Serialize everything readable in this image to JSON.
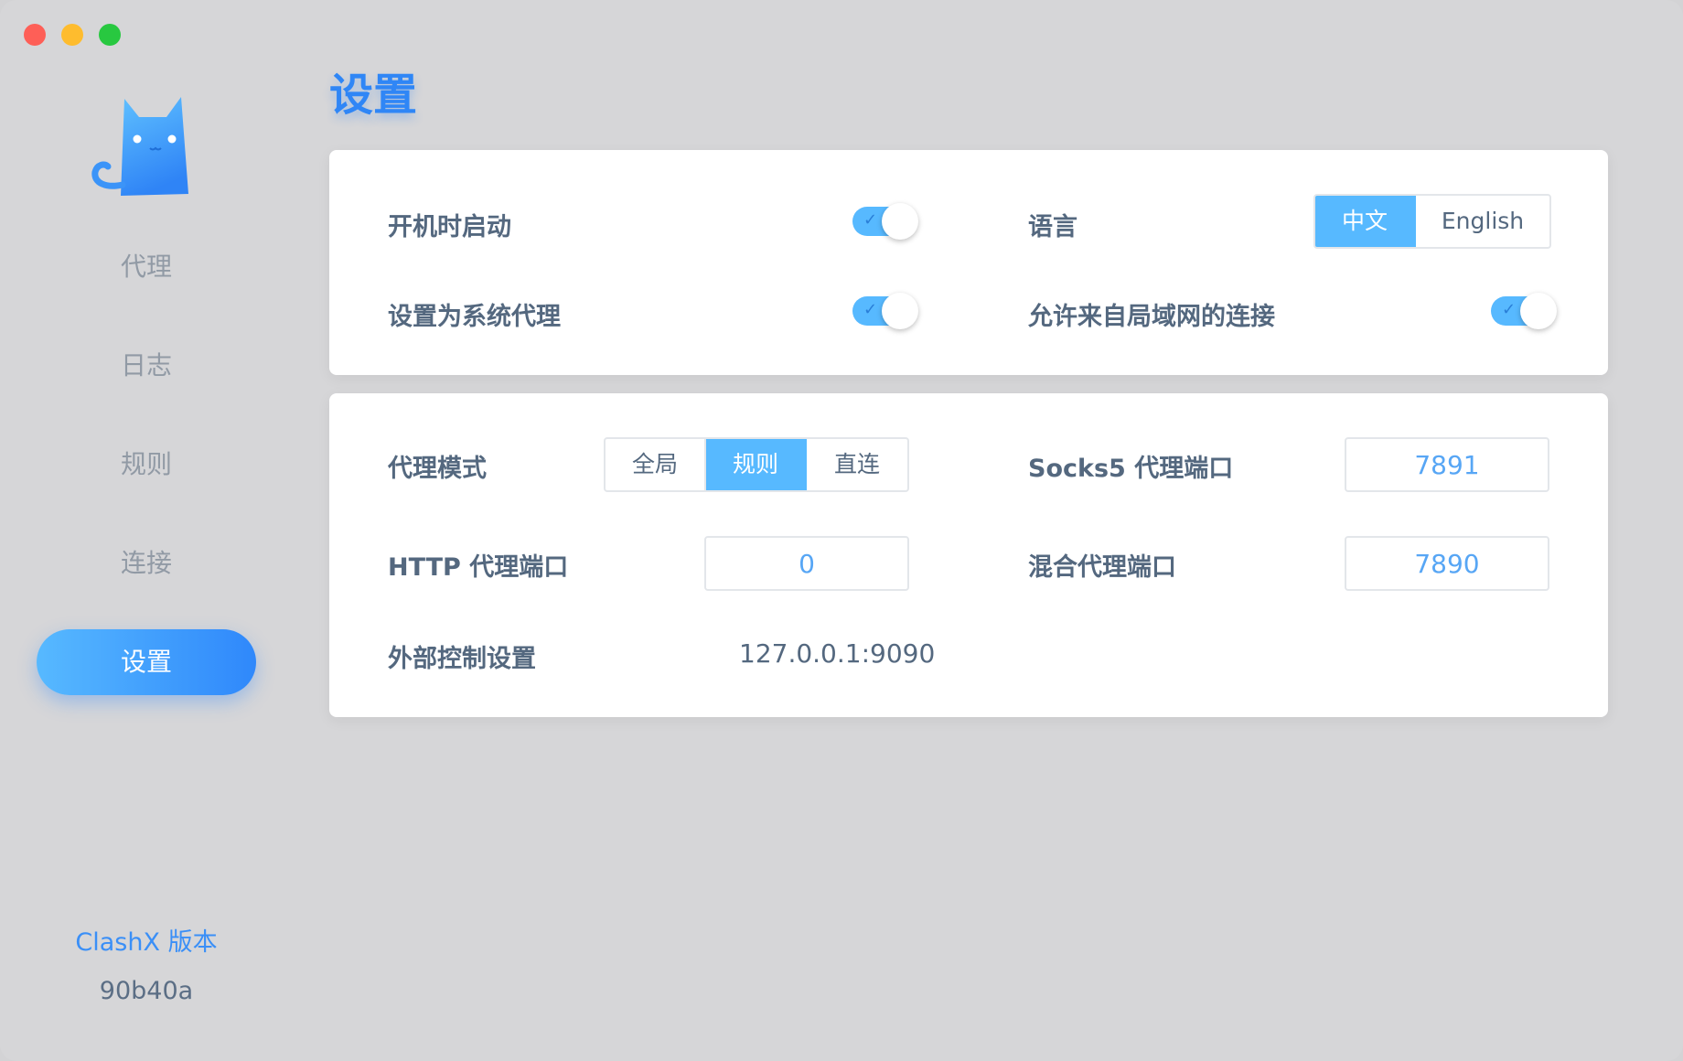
{
  "sidebar": {
    "items": [
      {
        "label": "代理"
      },
      {
        "label": "日志"
      },
      {
        "label": "规则"
      },
      {
        "label": "连接"
      },
      {
        "label": "设置"
      }
    ],
    "active_index": 4,
    "version_label": "ClashX 版本",
    "version_value": "90b40a"
  },
  "page": {
    "title": "设置"
  },
  "general": {
    "launch_at_login": {
      "label": "开机时启动",
      "enabled": true
    },
    "system_proxy": {
      "label": "设置为系统代理",
      "enabled": true
    },
    "language": {
      "label": "语言",
      "options": [
        "中文",
        "English"
      ],
      "selected": "中文"
    },
    "allow_lan": {
      "label": "允许来自局域网的连接",
      "enabled": true
    }
  },
  "proxy": {
    "mode": {
      "label": "代理模式",
      "options": [
        "全局",
        "规则",
        "直连"
      ],
      "selected": "规则"
    },
    "socks5_port": {
      "label": "Socks5 代理端口",
      "value": "7891"
    },
    "http_port": {
      "label": "HTTP 代理端口",
      "value": "0"
    },
    "mixed_port": {
      "label": "混合代理端口",
      "value": "7890"
    },
    "external_controller": {
      "label": "外部控制设置",
      "value": "127.0.0.1:9090"
    }
  },
  "colors": {
    "accent": "#57b9ff",
    "accent_dark": "#2f86f6",
    "text": "#54687f",
    "window_bg": "#d6d6d8"
  }
}
